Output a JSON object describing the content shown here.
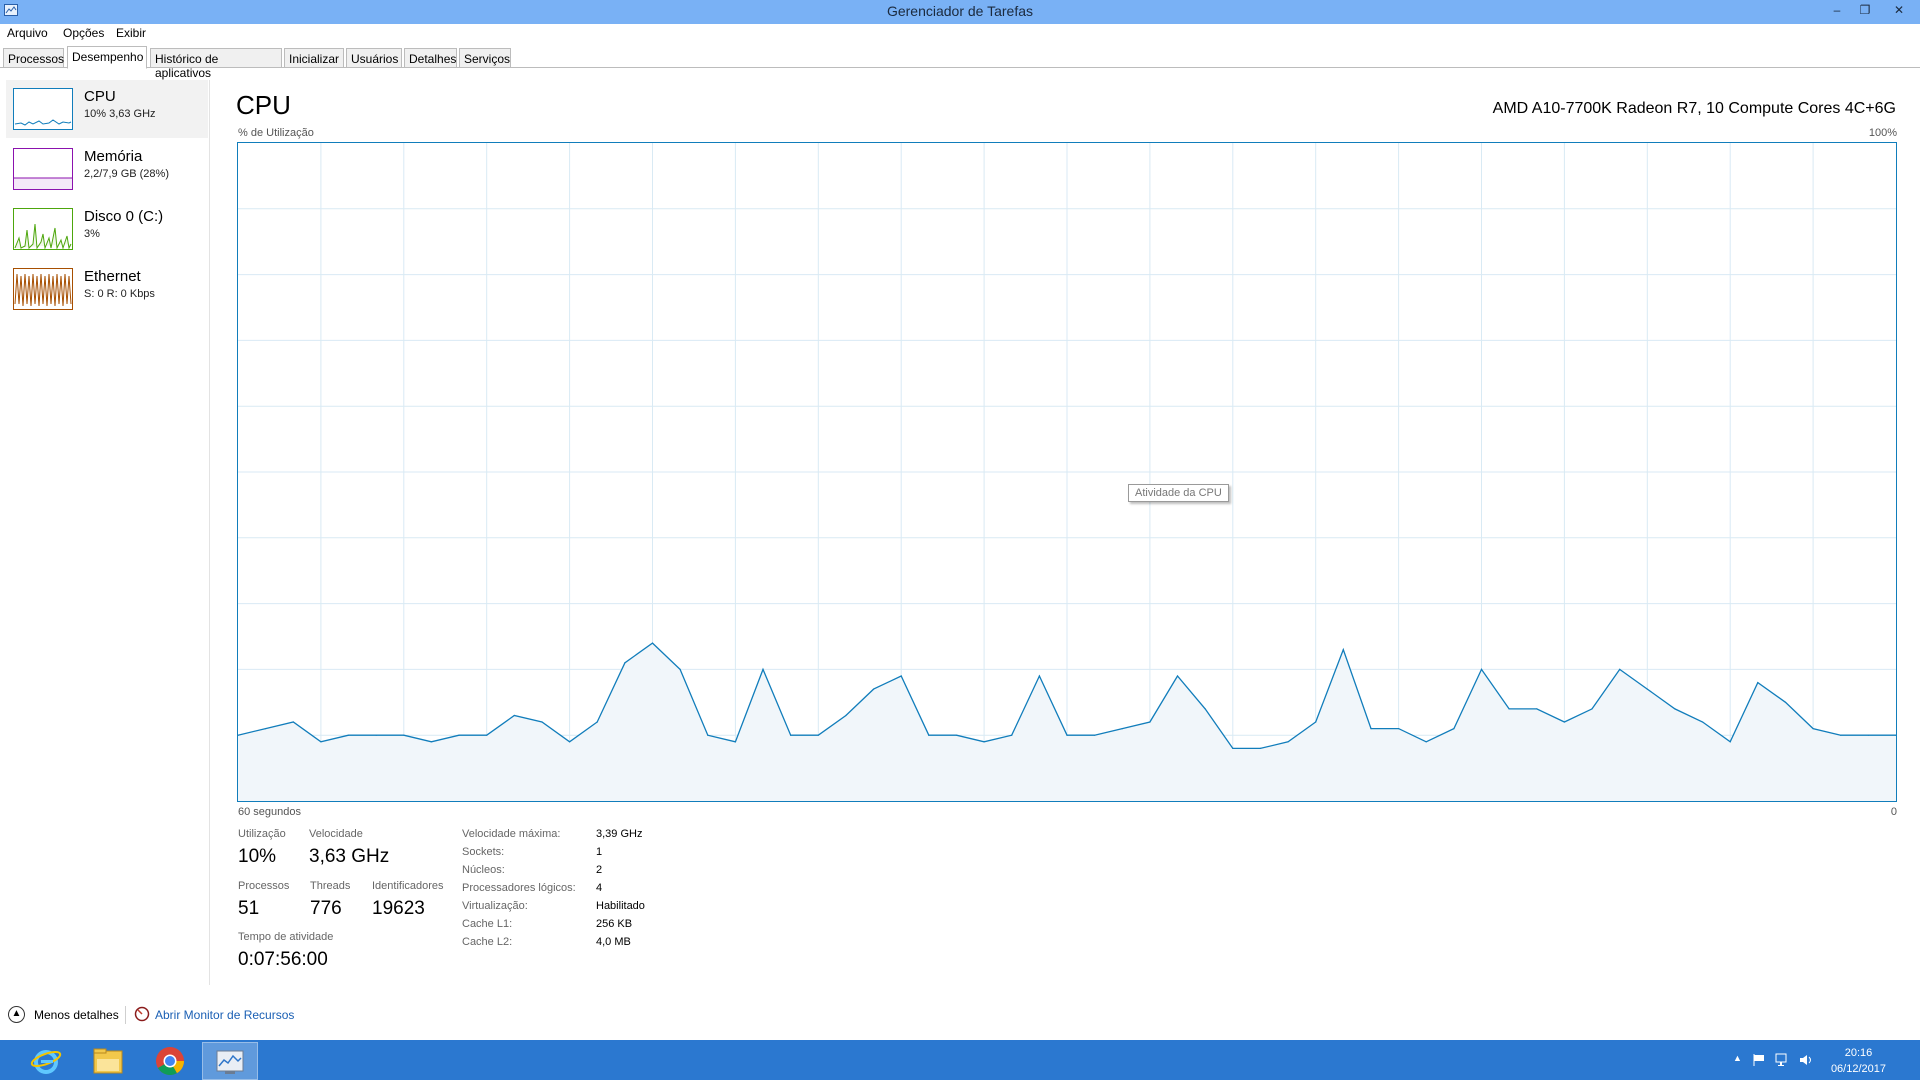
{
  "window": {
    "title": "Gerenciador de Tarefas",
    "icon": "task-manager-icon",
    "controls": {
      "minimize": "–",
      "restore": "❐",
      "close": "✕"
    }
  },
  "menu": [
    "Arquivo",
    "Opções",
    "Exibir"
  ],
  "tabs": [
    {
      "label": "Processos",
      "active": false
    },
    {
      "label": "Desempenho",
      "active": true
    },
    {
      "label": "Histórico de aplicativos",
      "active": false
    },
    {
      "label": "Inicializar",
      "active": false
    },
    {
      "label": "Usuários",
      "active": false
    },
    {
      "label": "Detalhes",
      "active": false
    },
    {
      "label": "Serviços",
      "active": false
    }
  ],
  "sidebar": {
    "items": [
      {
        "title": "CPU",
        "subtitle": "10% 3,63 GHz",
        "color": "#117dbb",
        "selected": true
      },
      {
        "title": "Memória",
        "subtitle": "2,2/7,9 GB (28%)",
        "color": "#8b12ae",
        "selected": false
      },
      {
        "title": "Disco 0 (C:)",
        "subtitle": "3%",
        "color": "#4da60c",
        "selected": false
      },
      {
        "title": "Ethernet",
        "subtitle": "S: 0 R: 0 Kbps",
        "color": "#a74f01",
        "selected": false
      }
    ]
  },
  "main": {
    "title": "CPU",
    "model": "AMD A10-7700K Radeon R7, 10 Compute Cores 4C+6G",
    "graph": {
      "y_label": "% de Utilização",
      "y_max_label": "100%",
      "x_left_label": "60 segundos",
      "x_right_label": "0",
      "tooltip": "Atividade da CPU",
      "line_color": "#117dbb",
      "fill_color": "#f1f6fa",
      "grid_color": "#d9eaf4"
    },
    "stats": {
      "utilizacao_label": "Utilização",
      "utilizacao": "10%",
      "velocidade_label": "Velocidade",
      "velocidade": "3,63 GHz",
      "processos_label": "Processos",
      "processos": "51",
      "threads_label": "Threads",
      "threads": "776",
      "identificadores_label": "Identificadores",
      "identificadores": "19623",
      "tempo_label": "Tempo de atividade",
      "tempo": "0:07:56:00"
    },
    "specs": [
      {
        "label": "Velocidade máxima:",
        "value": "3,39 GHz"
      },
      {
        "label": "Sockets:",
        "value": "1"
      },
      {
        "label": "Núcleos:",
        "value": "2"
      },
      {
        "label": "Processadores lógicos:",
        "value": "4"
      },
      {
        "label": "Virtualização:",
        "value": "Habilitado"
      },
      {
        "label": "Cache L1:",
        "value": "256 KB"
      },
      {
        "label": "Cache L2:",
        "value": "4,0 MB"
      }
    ]
  },
  "footer": {
    "less_details": "Menos detalhes",
    "resource_monitor": "Abrir Monitor de Recursos"
  },
  "chart_data": {
    "type": "area",
    "x_unit": "segundos atrás",
    "y_unit": "% de Utilização",
    "xlim": [
      60,
      0
    ],
    "ylim": [
      0,
      100
    ],
    "x": [
      60,
      59,
      58,
      57,
      56,
      55,
      54,
      53,
      52,
      51,
      50,
      49,
      48,
      47,
      46,
      45,
      44,
      43,
      42,
      41,
      40,
      39,
      38,
      37,
      36,
      35,
      34,
      33,
      32,
      31,
      30,
      29,
      28,
      27,
      26,
      25,
      24,
      23,
      22,
      21,
      20,
      19,
      18,
      17,
      16,
      15,
      14,
      13,
      12,
      11,
      10,
      9,
      8,
      7,
      6,
      5,
      4,
      3,
      2,
      1,
      0
    ],
    "values": [
      10,
      11,
      12,
      9,
      10,
      10,
      10,
      9,
      10,
      10,
      13,
      12,
      9,
      12,
      21,
      24,
      20,
      10,
      9,
      20,
      10,
      10,
      13,
      17,
      19,
      10,
      10,
      9,
      10,
      19,
      10,
      10,
      11,
      12,
      19,
      14,
      8,
      8,
      9,
      12,
      23,
      11,
      11,
      9,
      11,
      20,
      14,
      14,
      12,
      14,
      20,
      17,
      14,
      12,
      9,
      18,
      15,
      11,
      10,
      10,
      10
    ]
  },
  "taskbar": {
    "apps": [
      {
        "name": "internet-explorer-icon",
        "active": false
      },
      {
        "name": "file-explorer-icon",
        "active": false
      },
      {
        "name": "chrome-icon",
        "active": false
      },
      {
        "name": "task-manager-icon",
        "active": true
      }
    ],
    "tray": {
      "chevron": "▲",
      "time": "20:16",
      "date": "06/12/2017"
    }
  }
}
